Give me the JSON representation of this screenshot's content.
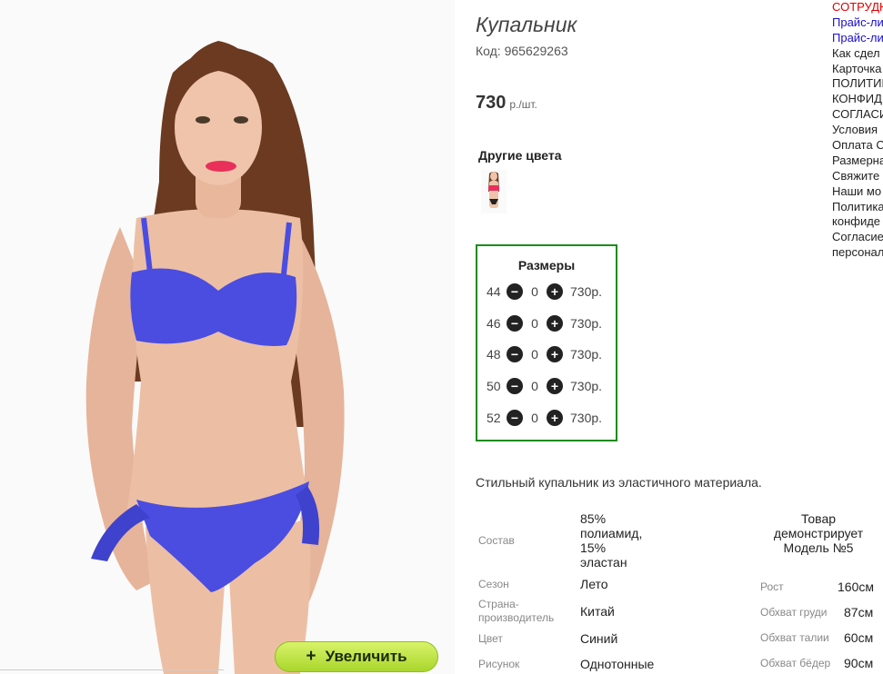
{
  "product": {
    "title": "Купальник",
    "code": "Код: 965629263",
    "price_amount": "730",
    "price_unit": "р./шт."
  },
  "other_colors": {
    "title": "Другие цвета"
  },
  "zoom": {
    "label": "Увеличить",
    "icon": "+"
  },
  "sizes": {
    "title": "Размеры",
    "rows": [
      {
        "size": "44",
        "qty": "0",
        "price": "730р."
      },
      {
        "size": "46",
        "qty": "0",
        "price": "730р."
      },
      {
        "size": "48",
        "qty": "0",
        "price": "730р."
      },
      {
        "size": "50",
        "qty": "0",
        "price": "730р."
      },
      {
        "size": "52",
        "qty": "0",
        "price": "730р."
      }
    ]
  },
  "description": "Стильный купальник из эластичного материала.",
  "specs": {
    "composition_label": "Состав",
    "composition_value_lines": [
      "85%",
      "полиамид,",
      "15%",
      "эластан"
    ],
    "season_label": "Сезон",
    "season_value": "Лето",
    "country_label_lines": [
      "Страна-",
      "производитель"
    ],
    "country_value": "Китай",
    "color_label": "Цвет",
    "color_value": "Синий",
    "pattern_label": "Рисунок",
    "pattern_value": "Однотонные"
  },
  "model": {
    "title_lines": [
      "Товар",
      "демонстрирует",
      "Модель №5"
    ],
    "height_label": "Рост",
    "height_value": "160см",
    "bust_label": "Обхват груди",
    "bust_value": "87см",
    "waist_label": "Обхват талии",
    "waist_value": "60см",
    "hips_label": "Обхват бёдер",
    "hips_value": "90см"
  },
  "side_links": [
    {
      "text": "СОТРУДН",
      "color": "red"
    },
    {
      "text": "Прайс-ли",
      "color": "blue"
    },
    {
      "text": "Прайс-ли",
      "color": "blue"
    },
    {
      "text": "Как сдел",
      "color": "dark"
    },
    {
      "text": "Карточка",
      "color": "dark"
    },
    {
      "text": "ПОЛИТИК",
      "color": "dark"
    },
    {
      "text": "КОНФИД",
      "color": "dark"
    },
    {
      "text": "СОГЛАСИ",
      "color": "dark"
    },
    {
      "text": "Условия",
      "color": "dark"
    },
    {
      "text": "Оплата С",
      "color": "dark"
    },
    {
      "text": "Размерна",
      "color": "dark"
    },
    {
      "text": "Свяжите",
      "color": "dark"
    },
    {
      "text": "Наши мо",
      "color": "dark"
    },
    {
      "text": "Политика",
      "color": "dark"
    },
    {
      "text": "конфиде",
      "color": "dark"
    },
    {
      "text": "Согласие",
      "color": "dark"
    },
    {
      "text": "персонал",
      "color": "dark"
    }
  ],
  "colors": {
    "accent_green": "#1b8c1b",
    "link_red": "#e00000",
    "link_blue": "#1a0dcc",
    "swimsuit_blue": "#4a4de0"
  }
}
